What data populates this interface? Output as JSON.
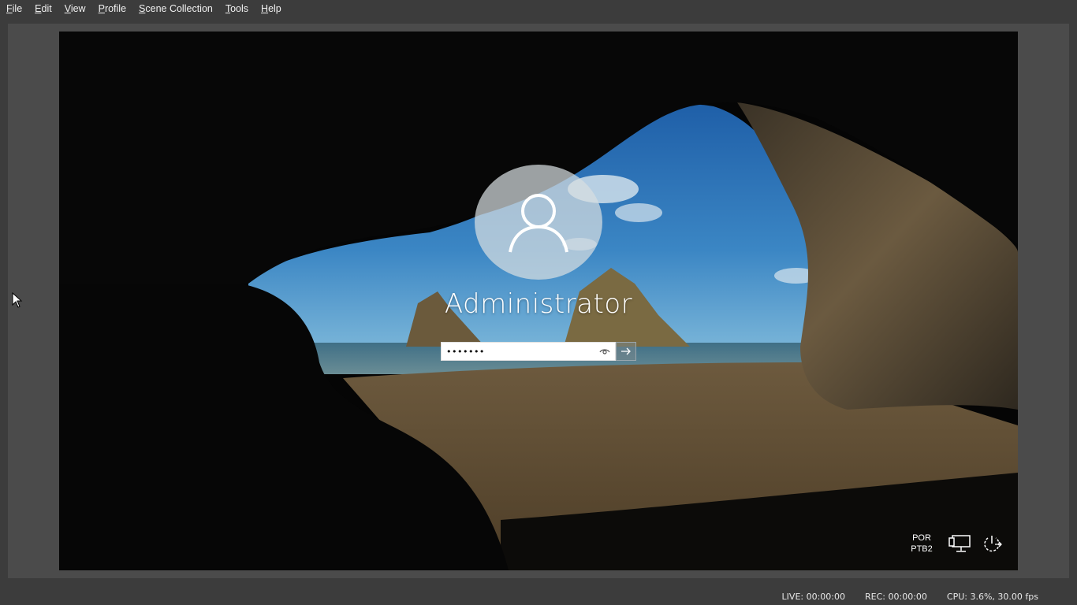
{
  "menu": {
    "items": [
      {
        "label_ul": "F",
        "label_rest": "ile"
      },
      {
        "label_ul": "E",
        "label_rest": "dit"
      },
      {
        "label_ul": "V",
        "label_rest": "iew"
      },
      {
        "label_ul": "P",
        "label_rest": "rofile"
      },
      {
        "label_ul": "S",
        "label_rest": "cene Collection"
      },
      {
        "label_ul": "T",
        "label_rest": "ools"
      },
      {
        "label_ul": "H",
        "label_rest": "elp"
      }
    ]
  },
  "lockscreen": {
    "username": "Administrator",
    "password_value": "•••••••",
    "language_line1": "POR",
    "language_line2": "PTB2",
    "icons": {
      "avatar": "user-icon",
      "reveal": "eye-icon",
      "submit": "arrow-right-icon",
      "network": "network-icon",
      "power": "power-icon"
    }
  },
  "status": {
    "live": "LIVE: 00:00:00",
    "rec": "REC: 00:00:00",
    "cpu": "CPU: 3.6%, 30.00 fps"
  },
  "colors": {
    "app_bg": "#3c3c3c",
    "preview_bg": "#4b4b4b",
    "text": "#f0f0f0"
  }
}
